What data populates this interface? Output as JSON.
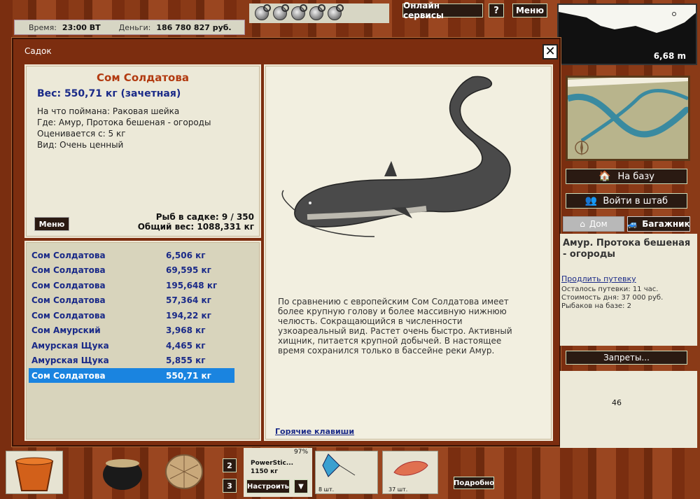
{
  "status": {
    "time_label": "Время:",
    "time_value": "23:00 ВТ",
    "money_label": "Деньги:",
    "money_value": "186 780 827 руб."
  },
  "topbar": {
    "online_label": "Онлайн сервисы",
    "help_label": "?",
    "menu_label": "Меню"
  },
  "depth": {
    "value": "6,68 m"
  },
  "dialog": {
    "title": "Садок",
    "close_label": "✕",
    "fish": {
      "name": "Сом Солдатова",
      "weight": "Вес: 550,71 кг (зачетная)",
      "bait": "На что поймана: Раковая шейка",
      "place": "Где: Амур, Протока бешеная - огороды",
      "value": "Оценивается с: 5 кг",
      "kind": "Вид: Очень ценный"
    },
    "menu_label": "Меню",
    "cage_count": "Рыб в садке: 9 / 350",
    "total_weight": "Общий вес: 1088,331 кг",
    "list": [
      {
        "name": "Сом Солдатова",
        "weight": "6,506 кг"
      },
      {
        "name": "Сом Солдатова",
        "weight": "69,595 кг"
      },
      {
        "name": "Сом Солдатова",
        "weight": "195,648 кг"
      },
      {
        "name": "Сом Солдатова",
        "weight": "57,364 кг"
      },
      {
        "name": "Сом Солдатова",
        "weight": "194,22 кг"
      },
      {
        "name": "Сом Амурский",
        "weight": "3,968 кг"
      },
      {
        "name": "Амурская Щука",
        "weight": "4,465 кг"
      },
      {
        "name": "Амурская Щука",
        "weight": "5,855 кг"
      },
      {
        "name": "Сом Солдатова",
        "weight": "550,71 кг"
      }
    ],
    "selected_index": 8,
    "description": "По сравнению с европейским Сом Солдатова имеет более крупную голову и более массивную нижнюю челюсть. Сокращающийся в численности узкоареальный вид. Растет очень быстро. Активный хищник, питается крупной добычей. В настоящее время сохранился только в бассейне реки Амур.",
    "hotkeys": "Горячие клавиши"
  },
  "right": {
    "base_label": "На базу",
    "hq_label": "Войти в штаб",
    "tab_home": "Дом",
    "tab_trunk": "Багажник",
    "location": "Амур. Протока бешеная - огороды",
    "extend_label": "Продлить путевку",
    "remaining": "Осталось путевки: 11 час.",
    "day_cost": "Стоимость дня: 37 000 руб.",
    "fishers": "Рыбаков на базе: 2",
    "bans_label": "Запреты...",
    "counter": "46"
  },
  "bottom": {
    "slot2": "2",
    "slot3": "3",
    "rod_name": "PowerStic...",
    "rod_value": "1150 кг",
    "rod_pct": "97%",
    "tune_label": "Настроить",
    "dropdown_label": "▼",
    "float_qty": "8 шт.",
    "bait_qty": "37 шт.",
    "details_label": "Подробно"
  },
  "colors": {
    "accent": "#b23a10",
    "list_text": "#1a2a88",
    "selection": "#1a84e0",
    "wood": "#7c2d0f"
  }
}
